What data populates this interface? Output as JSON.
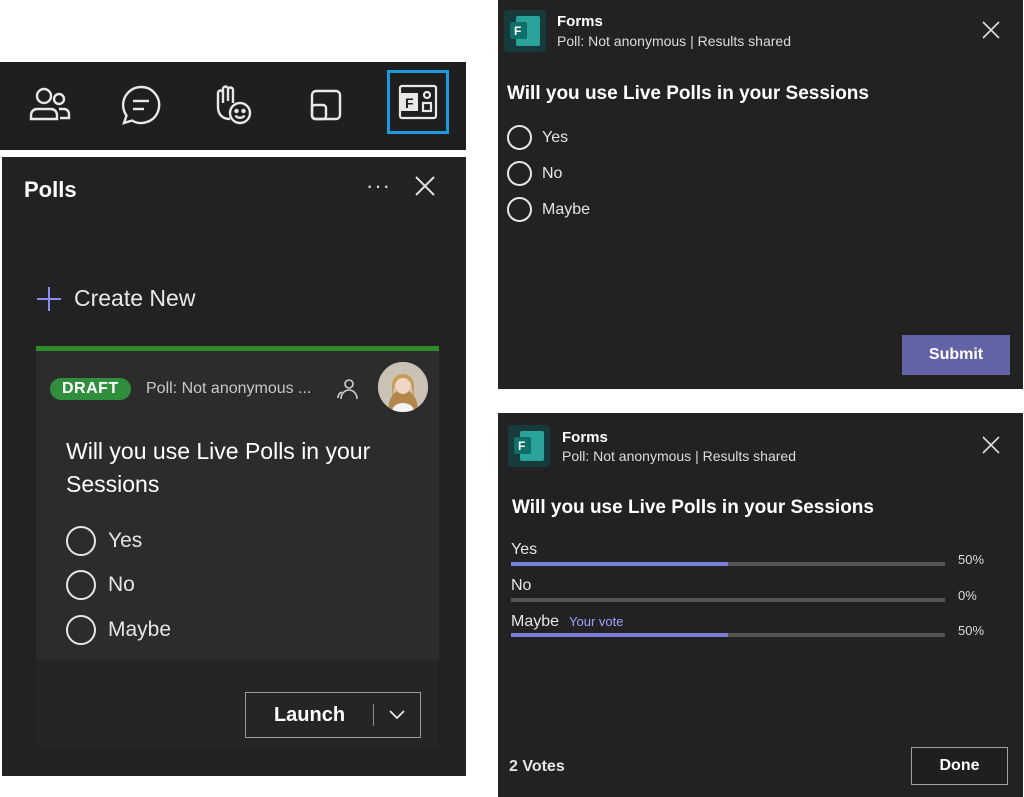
{
  "toolbar": {
    "icons": [
      "people-icon",
      "chat-icon",
      "raise-hand-reactions-icon",
      "share-tray-icon",
      "forms-app-icon"
    ],
    "highlight_color": "#1a9be0"
  },
  "polls": {
    "title": "Polls",
    "more": "···",
    "create_new": "Create New",
    "card": {
      "badge": "DRAFT",
      "meta": "Poll: Not anonymous ...",
      "question": "Will you use Live Polls in your Sessions",
      "options": [
        "Yes",
        "No",
        "Maybe"
      ],
      "launch": "Launch"
    },
    "accent_color": "#2e8b2a"
  },
  "forms_vote": {
    "app_name": "Forms",
    "meta": "Poll: Not anonymous | Results shared",
    "question": "Will you use Live Polls in your Sessions",
    "options": [
      "Yes",
      "No",
      "Maybe"
    ],
    "submit": "Submit",
    "accent_color": "#6264a7"
  },
  "forms_results": {
    "app_name": "Forms",
    "meta": "Poll: Not anonymous | Results shared",
    "question": "Will you use Live Polls in your Sessions",
    "results": [
      {
        "label": "Yes",
        "percent_text": "50%",
        "percent": 50,
        "your_vote": ""
      },
      {
        "label": "No",
        "percent_text": "0%",
        "percent": 0,
        "your_vote": ""
      },
      {
        "label": "Maybe",
        "percent_text": "50%",
        "percent": 50,
        "your_vote": "Your vote"
      }
    ],
    "votes": "2 Votes",
    "done": "Done"
  }
}
